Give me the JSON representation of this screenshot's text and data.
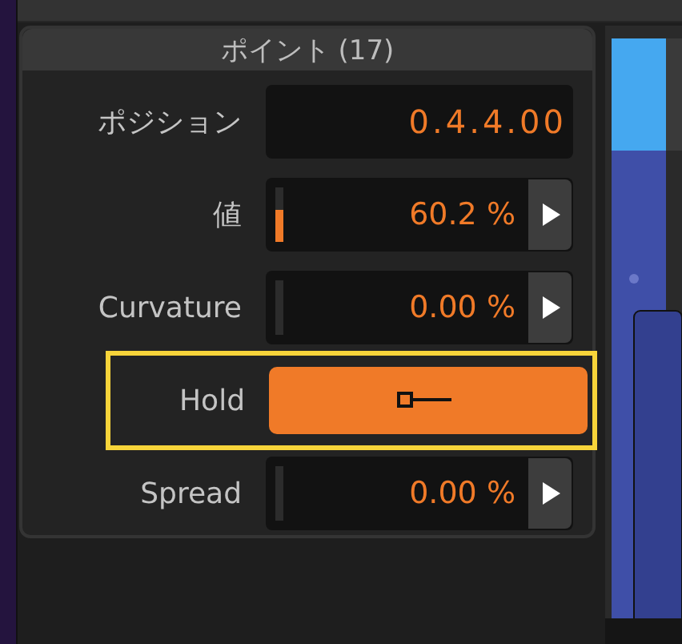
{
  "panel": {
    "title": "ポイント (17)",
    "rows": [
      {
        "kind": "text",
        "label": "ポジション",
        "value": "0.4.4.00",
        "highlighted": false
      },
      {
        "kind": "slider",
        "label": "値",
        "value": "60.2 %",
        "level": 0.602,
        "highlighted": false
      },
      {
        "kind": "slider",
        "label": "Curvature",
        "value": "0.00 %",
        "level": 0,
        "highlighted": false
      },
      {
        "kind": "toggle",
        "label": "Hold",
        "highlighted": true
      },
      {
        "kind": "slider",
        "label": "Spread",
        "value": "0.00 %",
        "level": 0,
        "highlighted": false
      }
    ]
  }
}
